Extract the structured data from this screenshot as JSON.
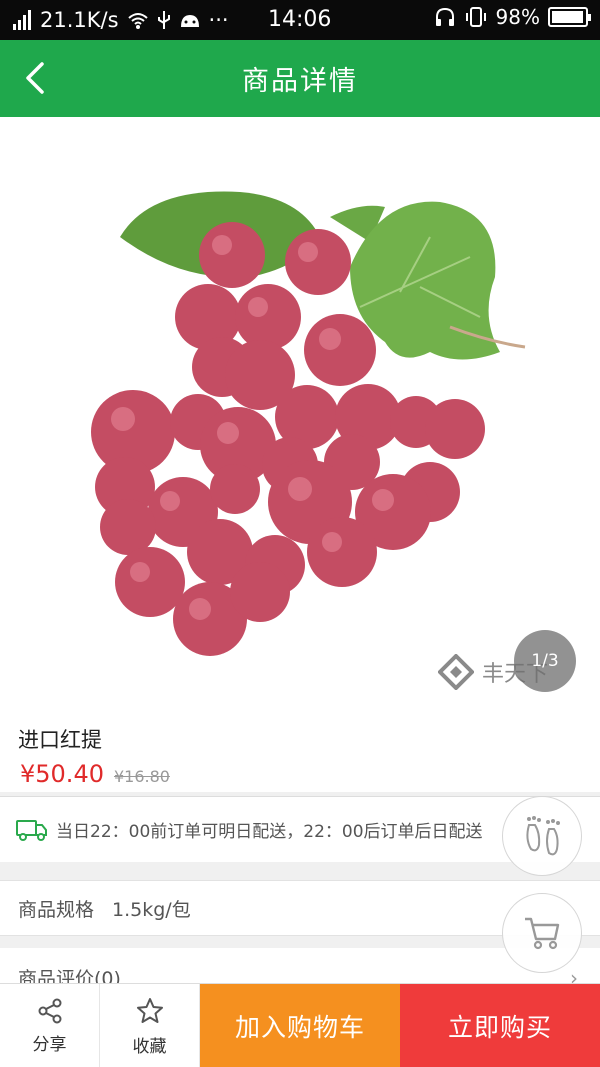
{
  "status_bar": {
    "net_speed": "21.1K/s",
    "time": "14:06",
    "battery": "98%",
    "battery_level": 0.98,
    "icons": [
      "signal-icon",
      "wifi-icon",
      "usb-icon",
      "android-icon",
      "more-icon",
      "headset-icon",
      "vibrate-icon",
      "battery-icon"
    ],
    "more": "···"
  },
  "header": {
    "title": "商品详情",
    "back_icon": "chevron-left-icon"
  },
  "gallery": {
    "pager": "1/3",
    "watermark": "丰天下"
  },
  "product": {
    "name": "进口红提",
    "price": "¥50.40",
    "original_price": "¥16.80"
  },
  "delivery": {
    "icon": "truck-icon",
    "text": "当日22：00前订单可明日配送，22：00后订单后日配送"
  },
  "spec": {
    "label": "商品规格",
    "value": "1.5kg/包"
  },
  "review": {
    "label": "商品评价(0)"
  },
  "floating": {
    "footprint_icon": "footprints-icon",
    "cart_icon": "cart-icon"
  },
  "bottom_bar": {
    "share_label": "分享",
    "favorite_label": "收藏",
    "add_to_cart_label": "加入购物车",
    "buy_now_label": "立即购买"
  },
  "colors": {
    "header": "#1fa84c",
    "price": "#e02a2a",
    "add_to_cart": "#f5901f",
    "buy_now": "#ef3b3b"
  }
}
